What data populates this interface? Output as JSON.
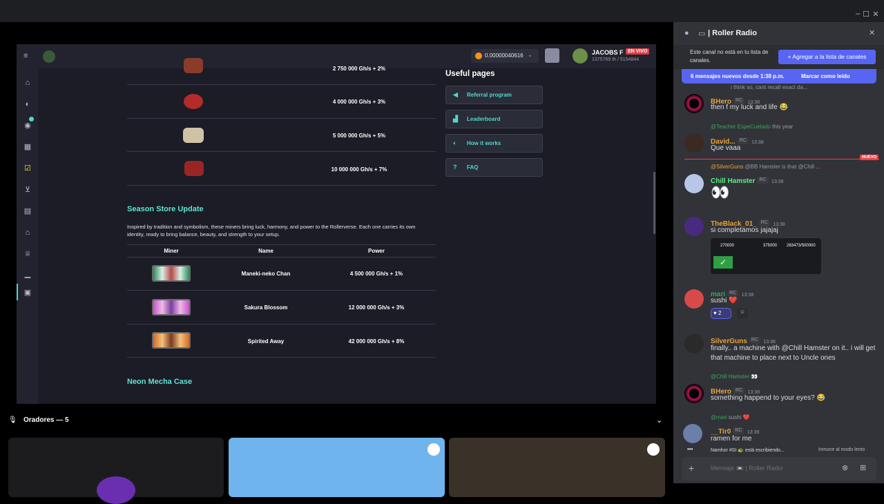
{
  "window": {
    "minimize": "–",
    "maximize": "☐",
    "close": "✕"
  },
  "app": {
    "balance": "0.00000040616",
    "user_name": "JACOBS F",
    "live_badge": "EN VIVO",
    "user_stats": "1375769 th / 5154844"
  },
  "upper_table": {
    "rows": [
      {
        "power": "2 750 000 Gh/s + 2%"
      },
      {
        "power": "4 000 000 Gh/s + 3%"
      },
      {
        "power": "5 000 000 Gh/s + 5%"
      },
      {
        "power": "10 000 000 Gh/s + 7%"
      }
    ]
  },
  "season": {
    "title": "Season Store Update",
    "desc": "Inspired by tradition and symbolism, these miners bring luck, harmony, and power to the Rollerverse. Each one carries its own identity, ready to bring balance, beauty, and strength to your setup.",
    "headers": {
      "miner": "Miner",
      "name": "Name",
      "power": "Power"
    },
    "rows": [
      {
        "name": "Maneki-neko Chan",
        "power": "4 500 000 Gh/s + 1%"
      },
      {
        "name": "Sakura Blossom",
        "power": "12 000 000 Gh/s + 3%"
      },
      {
        "name": "Spirited Away",
        "power": "42 000 000 Gh/s + 8%"
      }
    ]
  },
  "next_section": "Neon Mecha Case",
  "useful": {
    "title": "Useful pages",
    "items": [
      "Referral program",
      "Leaderboard",
      "How it works",
      "FAQ"
    ]
  },
  "speakers": {
    "label": "Oradores — 5"
  },
  "discord": {
    "channel": "| Roller Radio",
    "notice": "Este canal no está en tu lista de canales.",
    "add_btn": "+ Agregar a la lista de canales",
    "new_msgs": "6 mensajes nuevos desde 1:38 p.m.",
    "mark_read": "Marcar como leído",
    "nuevo": "NUEVO",
    "top_reply": "i think so, cant recall exact da...",
    "messages": [
      {
        "name": "BHero",
        "time": "13:38",
        "text": "then f my luck and life 😂",
        "color": "#e6a23c"
      },
      {
        "reply_user": "@Teacher EspeCuelado",
        "reply_text": "this year",
        "name": "David...",
        "time": "13:38",
        "text": "Que vaaa",
        "color": "#e6a23c"
      },
      {
        "reply_user": "@SilverGuns",
        "reply_text": "@BB Hamster is that @Chill ...",
        "name": "Chill Hamster",
        "time": "13:38",
        "text": "👀",
        "color": "#57f287"
      },
      {
        "name": "TheBlack_01_",
        "time": "13:38",
        "text": "si completamos jajajaj",
        "color": "#e6a23c"
      },
      {
        "name": "mari",
        "time": "13:38",
        "text": "sushi ❤️",
        "color": "#3ba55c",
        "reaction": "2"
      },
      {
        "name": "SilverGuns",
        "time": "13:38",
        "text": "finally.. a machine with @Chill Hamster on it.. i will get that machine to place next to Uncle ones",
        "color": "#e6a23c"
      },
      {
        "reply_user": "@Chill Hamster",
        "reply_text": "👀",
        "name": "BHero",
        "time": "13:38",
        "text": "something happend to your eyes? 😂",
        "color": "#e6a23c"
      },
      {
        "reply_user": "@mari",
        "reply_text": "sushi ❤️",
        "name": "__Tir0",
        "time": "13:39",
        "text": "ramen for me",
        "color": "#e6a23c"
      }
    ],
    "img_stats": [
      "270000",
      "375000",
      "283473/500000"
    ],
    "typing": "Namhor #SI 🐢 está escribiendo...",
    "slowmode": "Inmune al modo lento",
    "rc": "RC",
    "input_placeholder": "Mensaje 📼 | Roller Radio"
  }
}
